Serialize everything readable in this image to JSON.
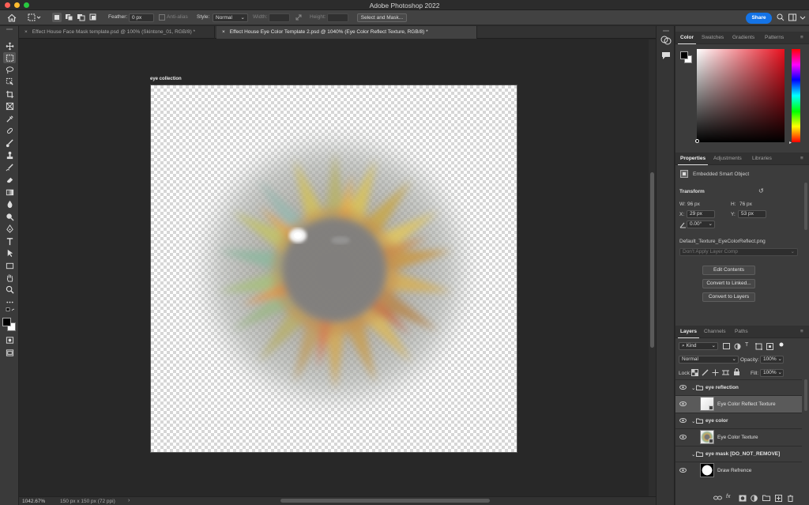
{
  "window": {
    "title": "Adobe Photoshop 2022"
  },
  "options": {
    "feather_label": "Feather:",
    "feather_value": "0 px",
    "anti_alias_label": "Anti-alias",
    "style_label": "Style:",
    "style_value": "Normal",
    "width_label": "Width:",
    "height_label": "Height:",
    "select_mask_label": "Select and Mask...",
    "share_label": "Share"
  },
  "tabs": [
    {
      "label": "Effect House Face Mask template.psd @ 100% (Skintone_01, RGB/8) *",
      "active": false
    },
    {
      "label": "Effect House Eye Color Template 2.psd @ 1040% (Eye Color Reflect Texture, RGB/8) *",
      "active": true
    }
  ],
  "canvas": {
    "artboard_label": "eye collection"
  },
  "status": {
    "zoom": "1042.67%",
    "doc_info": "150 px x 150 px (72 ppi)",
    "arrow": "›"
  },
  "color_panel": {
    "tabs": [
      "Color",
      "Swatches",
      "Gradients",
      "Patterns"
    ],
    "active": "Color"
  },
  "properties_panel": {
    "tabs": [
      "Properties",
      "Adjustments",
      "Libraries"
    ],
    "active": "Properties",
    "object_type": "Embedded Smart Object",
    "transform_label": "Transform",
    "w_label": "W:",
    "w_value": "96 px",
    "h_label": "H:",
    "h_value": "76 px",
    "x_label": "X:",
    "x_value": "29 px",
    "y_label": "Y:",
    "y_value": "53 px",
    "angle_value": "0.00°",
    "filename": "Default_Texture_EyeColorReflect.png",
    "layer_comp": "Don't Apply Layer Comp",
    "edit_contents": "Edit Contents",
    "convert_linked": "Convert to Linked...",
    "convert_layers": "Convert to Layers"
  },
  "layers_panel": {
    "tabs": [
      "Layers",
      "Channels",
      "Paths"
    ],
    "active": "Layers",
    "filter_kind": "Kind",
    "blend_mode": "Normal",
    "opacity_label": "Opacity:",
    "opacity_value": "100%",
    "lock_label": "Lock:",
    "fill_label": "Fill:",
    "fill_value": "100%",
    "layers": [
      {
        "name": "eye reflection",
        "type": "group",
        "visible": true
      },
      {
        "name": "Eye Color Reflect Texture",
        "type": "layer",
        "visible": true,
        "selected": true
      },
      {
        "name": "eye color",
        "type": "group",
        "visible": true
      },
      {
        "name": "Eye Color Texture",
        "type": "layer",
        "visible": true
      },
      {
        "name": "eye mask [DO_NOT_REMOVE]",
        "type": "group",
        "visible": false
      },
      {
        "name": "Draw Refrence",
        "type": "layer",
        "visible": true
      }
    ]
  },
  "colors": {
    "accent": "#1473e6",
    "panel_bg": "#3c3c3c",
    "canvas_bg": "#282828"
  }
}
